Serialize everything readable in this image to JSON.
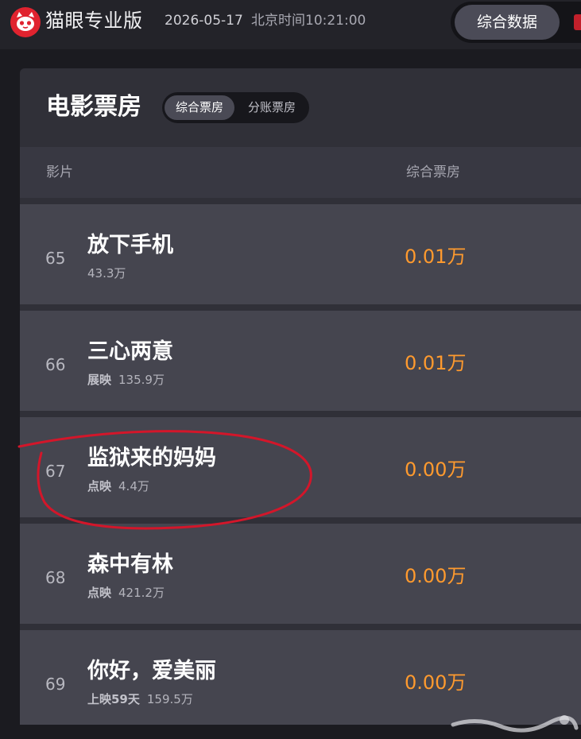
{
  "header": {
    "brand": "猫眼专业版",
    "date": "2026-05-17",
    "time": "北京时间10:21:00",
    "tabs": {
      "active": "综合数据"
    }
  },
  "panel": {
    "title": "电影票房",
    "segments": [
      "综合票房",
      "分账票房"
    ],
    "columns": {
      "film": "影片",
      "boxoffice": "综合票房"
    }
  },
  "rows": [
    {
      "rank": "65",
      "name": "放下手机",
      "tag": "",
      "total": "43.3万",
      "today": "0.01万"
    },
    {
      "rank": "66",
      "name": "三心两意",
      "tag": "展映",
      "total": "135.9万",
      "today": "0.01万"
    },
    {
      "rank": "67",
      "name": "监狱来的妈妈",
      "tag": "点映",
      "total": "4.4万",
      "today": "0.00万"
    },
    {
      "rank": "68",
      "name": "森中有林",
      "tag": "点映",
      "total": "421.2万",
      "today": "0.00万"
    },
    {
      "rank": "69",
      "name": "你好，爱美丽",
      "tag": "上映59天",
      "total": "159.5万",
      "today": "0.00万"
    }
  ],
  "colors": {
    "accent_orange": "#ff9a2e",
    "brand_red": "#e0232f",
    "annotation_red": "#d3162a"
  },
  "icons": {
    "logo": "maoyan-cat-logo-icon"
  }
}
